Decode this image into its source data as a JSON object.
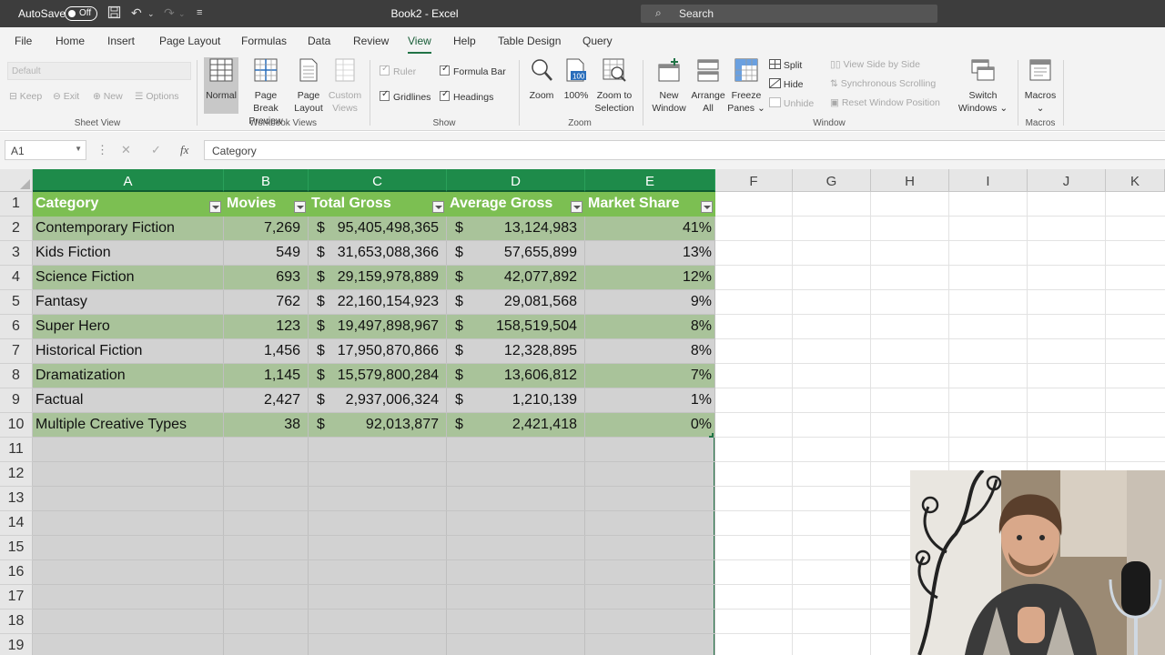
{
  "titlebar": {
    "autosave_label": "AutoSave",
    "autosave_state": "Off",
    "doc_title": "Book2 - Excel",
    "search_placeholder": "Search"
  },
  "menu": {
    "tabs": [
      "File",
      "Home",
      "Insert",
      "Page Layout",
      "Formulas",
      "Data",
      "Review",
      "View",
      "Help",
      "Table Design",
      "Query"
    ],
    "active": "View"
  },
  "ribbon": {
    "sheet_view": {
      "dropdown": "Default",
      "keep": "Keep",
      "exit": "Exit",
      "new": "New",
      "options": "Options",
      "label": "Sheet View"
    },
    "workbook_views": {
      "normal": "Normal",
      "page_break_1": "Page Break",
      "page_break_2": "Preview",
      "page_layout_1": "Page",
      "page_layout_2": "Layout",
      "custom_1": "Custom",
      "custom_2": "Views",
      "label": "Workbook Views"
    },
    "show": {
      "ruler": "Ruler",
      "formula_bar": "Formula Bar",
      "gridlines": "Gridlines",
      "headings": "Headings",
      "label": "Show"
    },
    "zoom": {
      "zoom": "Zoom",
      "hundred": "100%",
      "zoom_sel_1": "Zoom to",
      "zoom_sel_2": "Selection",
      "label": "Zoom"
    },
    "window": {
      "new_1": "New",
      "new_2": "Window",
      "arrange_1": "Arrange",
      "arrange_2": "All",
      "freeze_1": "Freeze",
      "freeze_2": "Panes",
      "split": "Split",
      "hide": "Hide",
      "unhide": "Unhide",
      "side_by_side": "View Side by Side",
      "sync_scroll": "Synchronous Scrolling",
      "reset_pos": "Reset Window Position",
      "switch_1": "Switch",
      "switch_2": "Windows",
      "label": "Window"
    },
    "macros": {
      "macros": "Macros",
      "label": "Macros"
    }
  },
  "formula_bar": {
    "name_box": "A1",
    "content": "Category"
  },
  "sheet": {
    "columns": [
      "A",
      "B",
      "C",
      "D",
      "E",
      "F",
      "G",
      "H",
      "I",
      "J",
      "K"
    ],
    "rows": [
      "1",
      "2",
      "3",
      "4",
      "5",
      "6",
      "7",
      "8",
      "9",
      "10",
      "11",
      "12",
      "13",
      "14",
      "15",
      "16",
      "17",
      "18",
      "19"
    ],
    "headers": [
      "Category",
      "Movies",
      "Total Gross",
      "Average Gross",
      "Market Share"
    ],
    "currency_symbol": "$",
    "data": [
      {
        "category": "Contemporary Fiction",
        "movies": "7,269",
        "total": "95,405,498,365",
        "avg": "13,124,983",
        "share": "41%"
      },
      {
        "category": "Kids Fiction",
        "movies": "549",
        "total": "31,653,088,366",
        "avg": "57,655,899",
        "share": "13%"
      },
      {
        "category": "Science Fiction",
        "movies": "693",
        "total": "29,159,978,889",
        "avg": "42,077,892",
        "share": "12%"
      },
      {
        "category": "Fantasy",
        "movies": "762",
        "total": "22,160,154,923",
        "avg": "29,081,568",
        "share": "9%"
      },
      {
        "category": "Super Hero",
        "movies": "123",
        "total": "19,497,898,967",
        "avg": "158,519,504",
        "share": "8%"
      },
      {
        "category": "Historical Fiction",
        "movies": "1,456",
        "total": "17,950,870,866",
        "avg": "12,328,895",
        "share": "8%"
      },
      {
        "category": "Dramatization",
        "movies": "1,145",
        "total": "15,579,800,284",
        "avg": "13,606,812",
        "share": "7%"
      },
      {
        "category": "Factual",
        "movies": "2,427",
        "total": "2,937,006,324",
        "avg": "1,210,139",
        "share": "1%"
      },
      {
        "category": "Multiple Creative Types",
        "movies": "38",
        "total": "92,013,877",
        "avg": "2,421,418",
        "share": "0%"
      }
    ]
  },
  "colors": {
    "excel_green": "#217346",
    "table_header": "#7cbf52",
    "band_green": "#a9c39a",
    "band_gray": "#d2d2d2"
  }
}
